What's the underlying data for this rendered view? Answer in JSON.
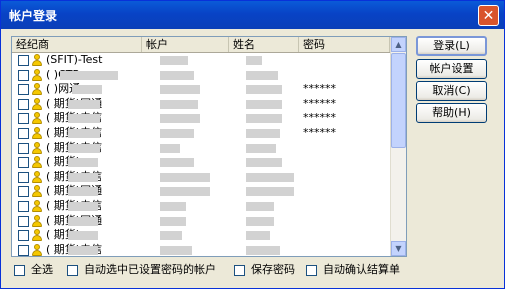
{
  "window": {
    "title": "帐户登录",
    "close_glyph": "✕"
  },
  "list": {
    "columns": [
      "经纪商",
      "帐户",
      "姓名",
      "密码"
    ],
    "rows": [
      {
        "broker": "(SFIT)-Test",
        "password": "",
        "blur": [
          [
            0,
            0
          ],
          [
            148,
            28
          ],
          [
            234,
            16
          ]
        ]
      },
      {
        "broker": "(        )CTP",
        "password": "",
        "blur": [
          [
            48,
            58
          ],
          [
            148,
            34
          ],
          [
            234,
            32
          ]
        ]
      },
      {
        "broker": "(         )网通",
        "password": "******",
        "blur": [
          [
            60,
            30
          ],
          [
            148,
            40
          ],
          [
            234,
            36
          ]
        ]
      },
      {
        "broker": "(      期货)网通",
        "password": "******",
        "blur": [
          [
            56,
            32
          ],
          [
            148,
            38
          ],
          [
            234,
            36
          ]
        ]
      },
      {
        "broker": "(      期货)电信",
        "password": "******",
        "blur": [
          [
            56,
            32
          ],
          [
            148,
            40
          ],
          [
            234,
            36
          ]
        ]
      },
      {
        "broker": "(      期货)电信",
        "password": "******",
        "blur": [
          [
            56,
            32
          ],
          [
            148,
            34
          ],
          [
            234,
            34
          ]
        ]
      },
      {
        "broker": "(      期货)电信",
        "password": "",
        "blur": [
          [
            56,
            32
          ],
          [
            148,
            20
          ],
          [
            234,
            30
          ]
        ]
      },
      {
        "broker": "(      期货)",
        "password": "",
        "blur": [
          [
            56,
            30
          ],
          [
            148,
            34
          ],
          [
            234,
            36
          ]
        ]
      },
      {
        "broker": "(      期货)电信",
        "password": "",
        "blur": [
          [
            56,
            30
          ],
          [
            148,
            50
          ],
          [
            234,
            48
          ]
        ]
      },
      {
        "broker": "(      期货)网通",
        "password": "",
        "blur": [
          [
            56,
            30
          ],
          [
            148,
            50
          ],
          [
            234,
            48
          ]
        ]
      },
      {
        "broker": "(      期货)电信",
        "password": "",
        "blur": [
          [
            56,
            30
          ],
          [
            148,
            26
          ],
          [
            234,
            28
          ]
        ]
      },
      {
        "broker": "(      期货)网通",
        "password": "",
        "blur": [
          [
            56,
            30
          ],
          [
            148,
            26
          ],
          [
            234,
            28
          ]
        ]
      },
      {
        "broker": "(      期货)",
        "password": "",
        "blur": [
          [
            56,
            30
          ],
          [
            148,
            22
          ],
          [
            234,
            24
          ]
        ]
      },
      {
        "broker": "(      期货)电信",
        "password": "",
        "blur": [
          [
            56,
            30
          ],
          [
            148,
            32
          ],
          [
            234,
            34
          ]
        ]
      }
    ]
  },
  "buttons": {
    "login": "登录(L)",
    "account_settings": "帐户设置",
    "cancel": "取消(C)",
    "help": "帮助(H)"
  },
  "options": {
    "select_all": "全选",
    "auto_select": "自动选中已设置密码的帐户",
    "save_password": "保存密码",
    "auto_confirm": "自动确认结算单"
  },
  "colors": {
    "title_bar": "#0a5bd8",
    "close_button": "#d9542b",
    "accent_border": "#7a97d8"
  }
}
